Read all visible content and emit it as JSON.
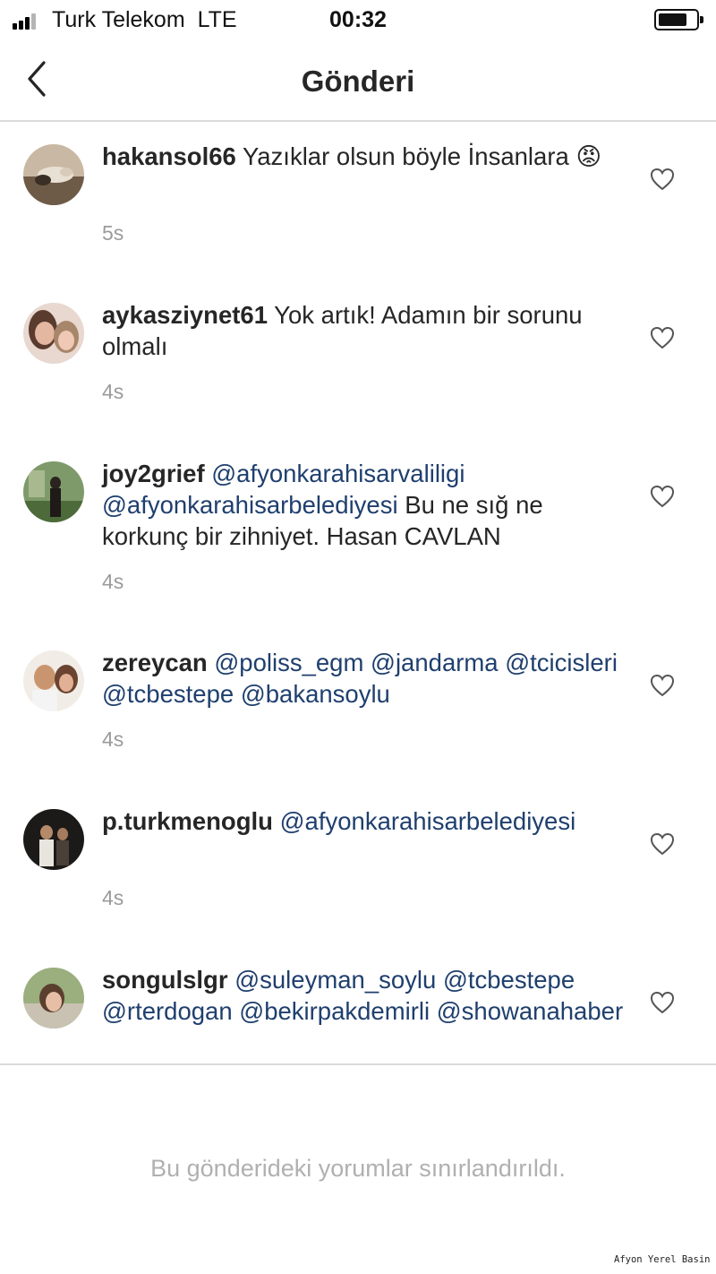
{
  "status_bar": {
    "carrier": "Turk Telekom",
    "network": "LTE",
    "time": "00:32",
    "signal_bars": 4,
    "signal_bars_active": 3,
    "battery_level": 0.75
  },
  "nav": {
    "back_icon": "chevron-left-icon",
    "title": "Gönderi"
  },
  "comments": [
    {
      "username": "hakansol66",
      "segments": [
        {
          "text": " Yazıklar olsun böyle İnsanlara ",
          "type": "text"
        },
        {
          "text": "😡",
          "type": "emoji"
        }
      ],
      "time": "5s"
    },
    {
      "username": "aykasziynet61",
      "segments": [
        {
          "text": " Yok artık! Adamın bir sorunu olmalı",
          "type": "text"
        }
      ],
      "time": "4s"
    },
    {
      "username": "joy2grief",
      "segments": [
        {
          "text": " ",
          "type": "text"
        },
        {
          "text": "@afyonkarahisarvaliligi",
          "type": "mention"
        },
        {
          "text": " ",
          "type": "text"
        },
        {
          "text": "@afyonkarahisarbelediyesi",
          "type": "mention"
        },
        {
          "text": " Bu ne sığ ne korkunç bir zihniyet. Hasan CAVLAN",
          "type": "text"
        }
      ],
      "time": "4s"
    },
    {
      "username": "zereycan",
      "segments": [
        {
          "text": " ",
          "type": "text"
        },
        {
          "text": "@poliss_egm",
          "type": "mention"
        },
        {
          "text": " ",
          "type": "text"
        },
        {
          "text": "@jandarma",
          "type": "mention"
        },
        {
          "text": " ",
          "type": "text"
        },
        {
          "text": "@tcicisleri",
          "type": "mention"
        },
        {
          "text": " ",
          "type": "text"
        },
        {
          "text": "@tcbestepe",
          "type": "mention"
        },
        {
          "text": " ",
          "type": "text"
        },
        {
          "text": "@bakansoylu",
          "type": "mention"
        }
      ],
      "time": "4s"
    },
    {
      "username": "p.turkmenoglu",
      "segments": [
        {
          "text": " ",
          "type": "text"
        },
        {
          "text": "@afyonkarahisarbelediyesi",
          "type": "mention"
        }
      ],
      "time": "4s"
    },
    {
      "username": "songulslgr",
      "segments": [
        {
          "text": " ",
          "type": "text"
        },
        {
          "text": "@suleyman_soylu",
          "type": "mention"
        },
        {
          "text": " ",
          "type": "text"
        },
        {
          "text": "@tcbestepe",
          "type": "mention"
        },
        {
          "text": " ",
          "type": "text"
        },
        {
          "text": "@rterdogan",
          "type": "mention"
        },
        {
          "text": " ",
          "type": "text"
        },
        {
          "text": "@bekirpakdemirli",
          "type": "mention"
        },
        {
          "text": " ",
          "type": "text"
        },
        {
          "text": "@showanahaber",
          "type": "mention"
        }
      ],
      "time": ""
    }
  ],
  "footer": {
    "restricted_notice": "Bu gönderideki yorumlar sınırlandırıldı.",
    "watermark": "Afyon Yerel Basin"
  },
  "colors": {
    "mention": "#1f3f6e",
    "timestamp": "#9b9b9b",
    "divider": "#dbdbdb",
    "notice": "#b0b0b0"
  }
}
